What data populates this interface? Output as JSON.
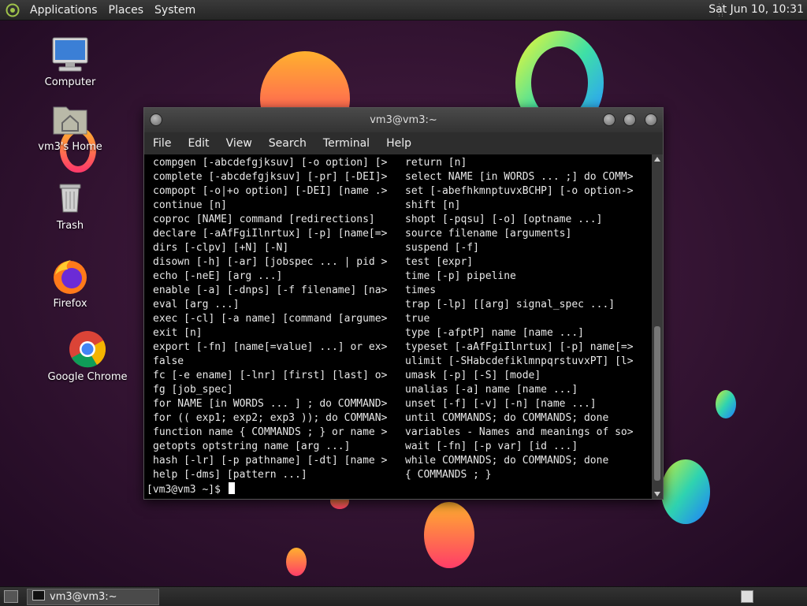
{
  "top_panel": {
    "menus": [
      "Applications",
      "Places",
      "System"
    ],
    "clock": "Sat Jun 10, 10:31"
  },
  "desktop_icons": [
    {
      "label": "Computer",
      "icon": "computer-icon"
    },
    {
      "label": "vm3's Home",
      "icon": "home-folder-icon"
    },
    {
      "label": "Trash",
      "icon": "trash-icon"
    },
    {
      "label": "Firefox",
      "icon": "firefox-icon"
    },
    {
      "label": "Google Chrome",
      "icon": "chrome-icon"
    }
  ],
  "terminal": {
    "title": "vm3@vm3:~",
    "menu": [
      "File",
      "Edit",
      "View",
      "Search",
      "Terminal",
      "Help"
    ],
    "left_column": [
      "compgen [-abcdefgjksuv] [-o option] [>",
      "complete [-abcdefgjksuv] [-pr] [-DEI]>",
      "compopt [-o|+o option] [-DEI] [name .>",
      "continue [n]",
      "coproc [NAME] command [redirections]",
      "declare [-aAfFgiIlnrtux] [-p] [name[=>",
      "dirs [-clpv] [+N] [-N]",
      "disown [-h] [-ar] [jobspec ... | pid >",
      "echo [-neE] [arg ...]",
      "enable [-a] [-dnps] [-f filename] [na>",
      "eval [arg ...]",
      "exec [-cl] [-a name] [command [argume>",
      "exit [n]",
      "export [-fn] [name[=value] ...] or ex>",
      "false",
      "fc [-e ename] [-lnr] [first] [last] o>",
      "fg [job_spec]",
      "for NAME [in WORDS ... ] ; do COMMAND>",
      "for (( exp1; exp2; exp3 )); do COMMAN>",
      "function name { COMMANDS ; } or name >",
      "getopts optstring name [arg ...]",
      "hash [-lr] [-p pathname] [-dt] [name >",
      "help [-dms] [pattern ...]"
    ],
    "right_column": [
      "return [n]",
      "select NAME [in WORDS ... ;] do COMM>",
      "set [-abefhkmnptuvxBCHP] [-o option->",
      "shift [n]",
      "shopt [-pqsu] [-o] [optname ...]",
      "source filename [arguments]",
      "suspend [-f]",
      "test [expr]",
      "time [-p] pipeline",
      "times",
      "trap [-lp] [[arg] signal_spec ...]",
      "true",
      "type [-afptP] name [name ...]",
      "typeset [-aAfFgiIlnrtux] [-p] name[=>",
      "ulimit [-SHabcdefiklmnpqrstuvxPT] [l>",
      "umask [-p] [-S] [mode]",
      "unalias [-a] name [name ...]",
      "unset [-f] [-v] [-n] [name ...]",
      "until COMMANDS; do COMMANDS; done",
      "variables - Names and meanings of so>",
      "wait [-fn] [-p var] [id ...]",
      "while COMMANDS; do COMMANDS; done",
      "{ COMMANDS ; }"
    ],
    "prompt": "[vm3@vm3 ~]$"
  },
  "bottom_panel": {
    "task_label": "vm3@vm3:~"
  }
}
